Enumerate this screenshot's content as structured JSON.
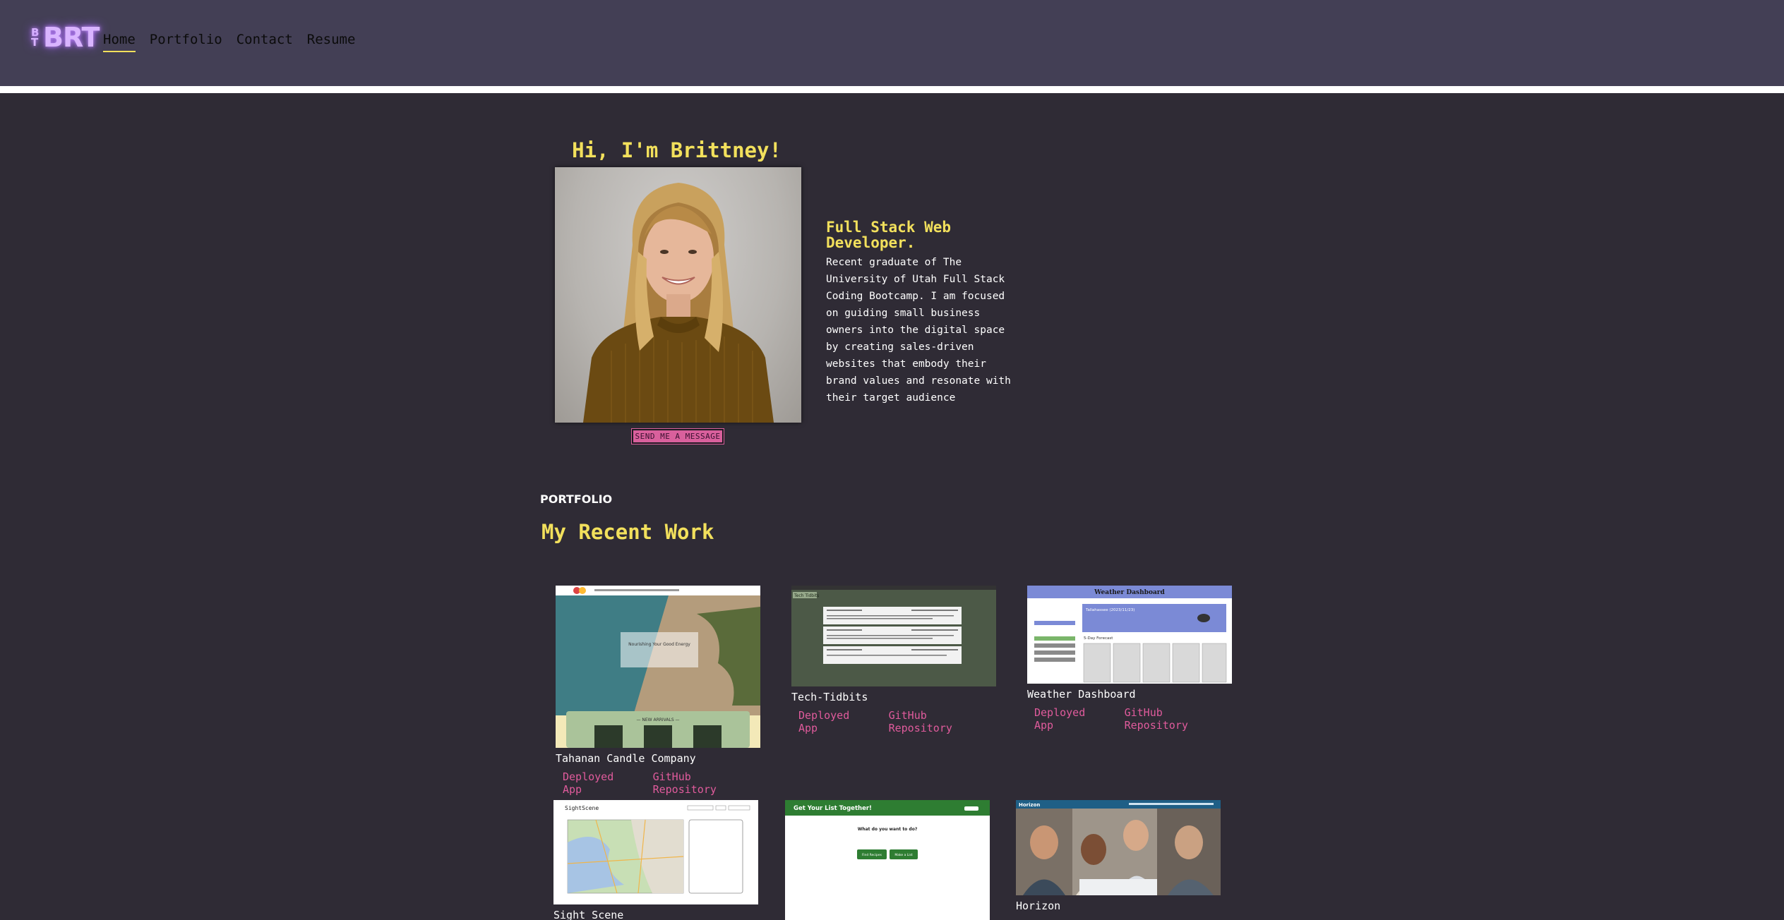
{
  "header": {
    "logo_small": "BT",
    "logo_main": "BRT",
    "nav": [
      {
        "label": "Home",
        "active": true
      },
      {
        "label": "Portfolio",
        "active": false
      },
      {
        "label": "Contact",
        "active": false
      },
      {
        "label": "Resume",
        "active": false
      }
    ]
  },
  "hero": {
    "greeting": "Hi, I'm Brittney!",
    "button": "SEND ME A MESSAGE",
    "role": "Full Stack Web Developer.",
    "bio": "Recent graduate of The University of Utah Full Stack Coding Bootcamp. I am focused on guiding small business owners into the digital space by creating sales-driven websites that embody their brand values and resonate with their target audience"
  },
  "portfolio": {
    "eyebrow": "PORTFOLIO",
    "title": "My Recent Work",
    "projects": [
      {
        "name": "Tahanan Candle Company",
        "deployed": "Deployed App",
        "repo": "GitHub Repository",
        "shot_text": [
          "Nourishing Your Good Energy",
          "— NEW ARRIVALS —"
        ]
      },
      {
        "name": "Tech-Tidbits",
        "deployed": "Deployed App",
        "repo": "GitHub Repository",
        "shot_text": [
          "Tech Tidbits"
        ]
      },
      {
        "name": "Weather Dashboard",
        "deployed": "Deployed App",
        "repo": "GitHub Repository",
        "shot_text": [
          "Weather Dashboard",
          "Tallahassee (2023/11/23)",
          "5-Day Forecast"
        ]
      },
      {
        "name": "Sight Scene",
        "deployed": "",
        "repo": "",
        "shot_text": [
          "SightScene"
        ]
      },
      {
        "name": "",
        "deployed": "",
        "repo": "",
        "shot_text": [
          "Get Your List Together!",
          "What do you want to do?",
          "Find Recipes",
          "Make a List"
        ]
      },
      {
        "name": "Horizon",
        "deployed": "",
        "repo": "",
        "shot_text": [
          "Horizon"
        ]
      }
    ]
  },
  "colors": {
    "background": "#2f2b35",
    "header": "#433f55",
    "accent_yellow": "#f2e05c",
    "link_pink": "#e05b9c",
    "logo_glow": "#c38bff"
  }
}
